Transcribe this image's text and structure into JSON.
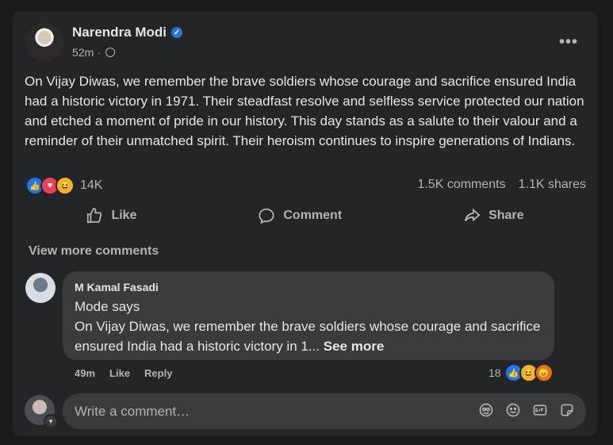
{
  "post": {
    "author": "Narendra Modi",
    "time": "52m",
    "separator": "·",
    "text": "On Vijay Diwas, we remember the brave soldiers whose courage and sacrifice ensured India had a historic victory in 1971. Their steadfast resolve and selfless service protected our nation and etched a moment of pride in our history. This day stands as a salute to their valour and a reminder of their unmatched spirit. Their heroism continues to inspire generations of Indians.",
    "reaction_count": "14K",
    "comments": "1.5K comments",
    "shares": "1.1K shares",
    "reactions": [
      "like",
      "love",
      "haha"
    ]
  },
  "actions": {
    "like": "Like",
    "comment": "Comment",
    "share": "Share"
  },
  "view_more": "View more comments",
  "comment": {
    "name": "M Kamal Fasadi",
    "line1": "Mode says",
    "line2": "On Vijay Diwas, we remember the brave soldiers whose courage and sacrifice ensured India had a historic victory in 1...",
    "see_more": "See more",
    "time": "49m",
    "like": "Like",
    "reply": "Reply",
    "reaction_count": "18",
    "reactions": [
      "like",
      "haha",
      "angry"
    ]
  },
  "composer": {
    "placeholder": "Write a comment…",
    "tools": [
      "avatar-sticker-icon",
      "emoji-icon",
      "gif-icon",
      "sticker-icon"
    ]
  },
  "colors": {
    "background": "#18191a",
    "card": "#242526",
    "bubble": "#3a3b3c",
    "accent": "#2374e1"
  }
}
